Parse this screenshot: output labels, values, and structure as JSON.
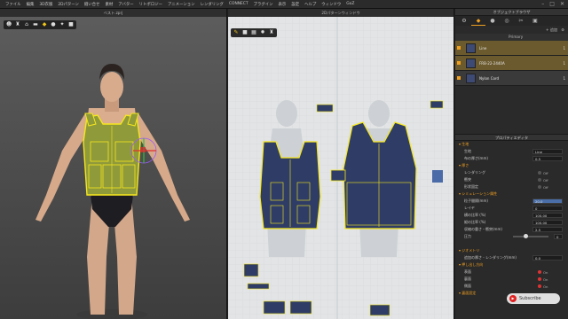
{
  "menu": [
    "ファイル",
    "編集",
    "3D衣服",
    "2Dパターン",
    "縫い合せ",
    "素材",
    "アバター",
    "リトポロジー",
    "アニメーション",
    "レンダリング",
    "CONNECT",
    "プラグイン",
    "表示",
    "設定",
    "ヘルプ",
    "ウィンドウ",
    "GoZ"
  ],
  "window_controls": [
    "–",
    "□",
    "✕"
  ],
  "pane3d": {
    "title": "ベスト.zprj",
    "toolbar_icons": [
      "avatar-icon",
      "shirt-icon",
      "hanger-icon",
      "shoe-icon",
      "texture-icon",
      "fabric-icon",
      "light-icon",
      "camera-icon"
    ]
  },
  "pane2d": {
    "title": "2Dパターンウィンドウ",
    "toolbar_icons": [
      "pen-icon",
      "square-icon",
      "grid-icon",
      "settings-icon",
      "shirt-icon"
    ]
  },
  "object_browser": {
    "title": "オブジェクトブラウザ",
    "tabs": [
      "gear-icon",
      "fabric-icon",
      "button-icon",
      "trim-icon",
      "topstitch-icon",
      "graphic-icon"
    ],
    "toolbar": [
      "+ 追加",
      "⚙"
    ],
    "section": "Primary",
    "fabrics": [
      {
        "name": "Line",
        "tag": "1",
        "selected": true
      },
      {
        "name": "FRB-22-2440A",
        "tag": "1",
        "selected": true
      },
      {
        "name": "Nylon Cord",
        "tag": "1",
        "selected": false
      }
    ]
  },
  "property_editor": {
    "title": "プロパティエディタ",
    "rows": [
      {
        "type": "section",
        "label": "▾ 生地"
      },
      {
        "type": "value",
        "label": "生地",
        "value": "Line"
      },
      {
        "type": "value",
        "label": "布の厚さ(mm)",
        "value": "0.5"
      },
      {
        "type": "section",
        "label": "▾ 厚さ"
      },
      {
        "type": "toggle",
        "label": "レンダリング",
        "value": "Off",
        "on": false
      },
      {
        "type": "toggle",
        "label": "衝突",
        "value": "Off",
        "on": false
      },
      {
        "type": "toggle",
        "label": "形状固定",
        "value": "Off",
        "on": false
      },
      {
        "type": "section",
        "label": "▾ シミュレーション属性"
      },
      {
        "type": "value",
        "label": "粒子間隔(mm)",
        "value": "20.0",
        "highlight": true
      },
      {
        "type": "value",
        "label": "レイヤ",
        "value": "0"
      },
      {
        "type": "value",
        "label": "横の比率 (%)",
        "value": "100.00"
      },
      {
        "type": "value",
        "label": "縦の比率 (%)",
        "value": "100.00"
      },
      {
        "type": "value",
        "label": "収縮の重さ・衝突(mm)",
        "value": "2.5"
      },
      {
        "type": "slider",
        "label": "圧力",
        "value": "0"
      },
      {
        "type": "blank",
        "label": ""
      },
      {
        "type": "section",
        "label": "▾ ジオメトリ"
      },
      {
        "type": "value",
        "label": "追加の厚さ - レンダリング(mm)",
        "value": "0.0"
      },
      {
        "type": "section",
        "label": "▾ 押し出し方向"
      },
      {
        "type": "toggle",
        "label": "表面",
        "value": "On",
        "on": true
      },
      {
        "type": "toggle",
        "label": "裏面",
        "value": "On",
        "on": true
      },
      {
        "type": "toggle",
        "label": "側面",
        "value": "On",
        "on": true
      },
      {
        "type": "section",
        "label": "▾ 裏面設定"
      }
    ]
  },
  "subscribe": {
    "label": "Subscribe",
    "icon": "play-icon"
  },
  "colors": {
    "accent": "#f0a020",
    "selection": "#f5e61c",
    "fabric_navy": "#2f3d66"
  }
}
